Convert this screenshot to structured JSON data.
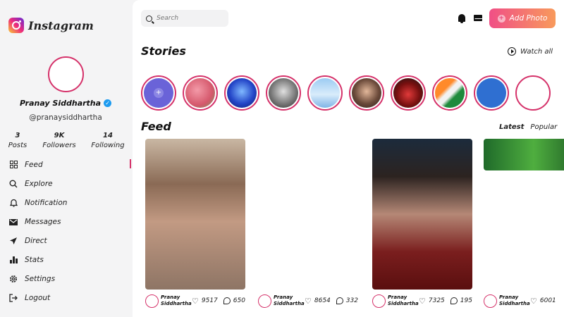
{
  "app": {
    "logo_text": "Instagram"
  },
  "profile": {
    "name": "Pranay Siddhartha",
    "handle": "@pranaysiddhartha",
    "stats": [
      {
        "value": "3",
        "label": "Posts"
      },
      {
        "value": "9K",
        "label": "Followers"
      },
      {
        "value": "14",
        "label": "Following"
      }
    ]
  },
  "nav": [
    {
      "label": "Feed",
      "icon": "grid-icon",
      "active": true
    },
    {
      "label": "Explore",
      "icon": "search-icon"
    },
    {
      "label": "Notification",
      "icon": "bell-icon"
    },
    {
      "label": "Messages",
      "icon": "mail-icon"
    },
    {
      "label": "Direct",
      "icon": "send-icon"
    },
    {
      "label": "Stats",
      "icon": "bar-chart-icon"
    },
    {
      "label": "Settings",
      "icon": "gear-icon"
    },
    {
      "label": "Logout",
      "icon": "logout-icon"
    }
  ],
  "header": {
    "search_placeholder": "Search",
    "add_photo_label": "Add Photo"
  },
  "stories": {
    "title": "Stories",
    "watch_all_label": "Watch all"
  },
  "feed": {
    "title": "Feed",
    "tabs": [
      "Latest",
      "Popular"
    ],
    "active_tab": "Latest",
    "posts": [
      {
        "author_line1": "Pranay",
        "author_line2": "Siddhartha",
        "likes": "9517",
        "comments": "650"
      },
      {
        "author_line1": "Pranay",
        "author_line2": "Siddhartha",
        "likes": "8654",
        "comments": "332"
      },
      {
        "author_line1": "Pranay",
        "author_line2": "Siddhartha",
        "likes": "7325",
        "comments": "195"
      },
      {
        "author_line1": "Pranay",
        "author_line2": "Siddhartha",
        "likes": "6001",
        "comments": ""
      }
    ]
  },
  "colors": {
    "accent": "#d5326a",
    "add_button_start": "#f04f86",
    "add_button_end": "#f89a5c",
    "verified": "#1d9bf0"
  }
}
